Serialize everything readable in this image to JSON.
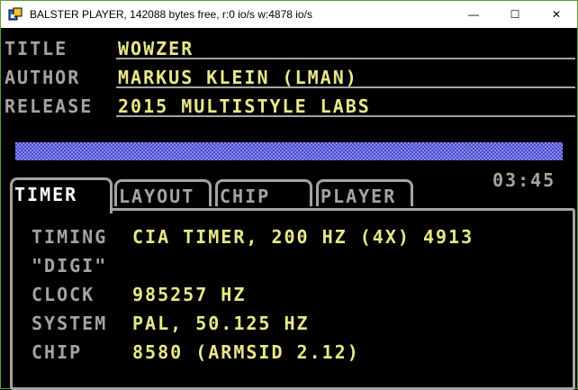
{
  "window": {
    "title": "BALSTER PLAYER, 142088 bytes free, r:0 io/s w:4878 io/s",
    "minimize_glyph": "—",
    "maximize_glyph": "☐",
    "close_glyph": "✕"
  },
  "song": {
    "title_label": "TITLE",
    "title": "WOWZER",
    "author_label": "AUTHOR",
    "author": "MARKUS KLEIN (LMAN)",
    "release_label": "RELEASE",
    "release": "2015 MULTISTYLE LABS"
  },
  "time": "03:45",
  "tabs": [
    {
      "label": "TIMER",
      "active": true
    },
    {
      "label": "LAYOUT",
      "active": false
    },
    {
      "label": "CHIP",
      "active": false
    },
    {
      "label": "PLAYER",
      "active": false
    }
  ],
  "timer_panel": {
    "rows": [
      {
        "label": "TIMING",
        "value": "CIA TIMER, 200 HZ (4X) 4913"
      },
      {
        "label": "\"DIGI\"",
        "value": ""
      },
      {
        "label": "CLOCK",
        "value": "985257 HZ"
      },
      {
        "label": "SYSTEM",
        "value": "PAL, 50.125 HZ"
      },
      {
        "label": "CHIP",
        "value": "8580 (ARMSID 2.12)"
      }
    ]
  },
  "colors": {
    "background": "#000000",
    "label_grey": "#a4a4a4",
    "value_yellow": "#e8e88a",
    "checker_light": "#8b8bf0",
    "checker_dark": "#4a4ac8",
    "window_border": "#5aa02c"
  }
}
